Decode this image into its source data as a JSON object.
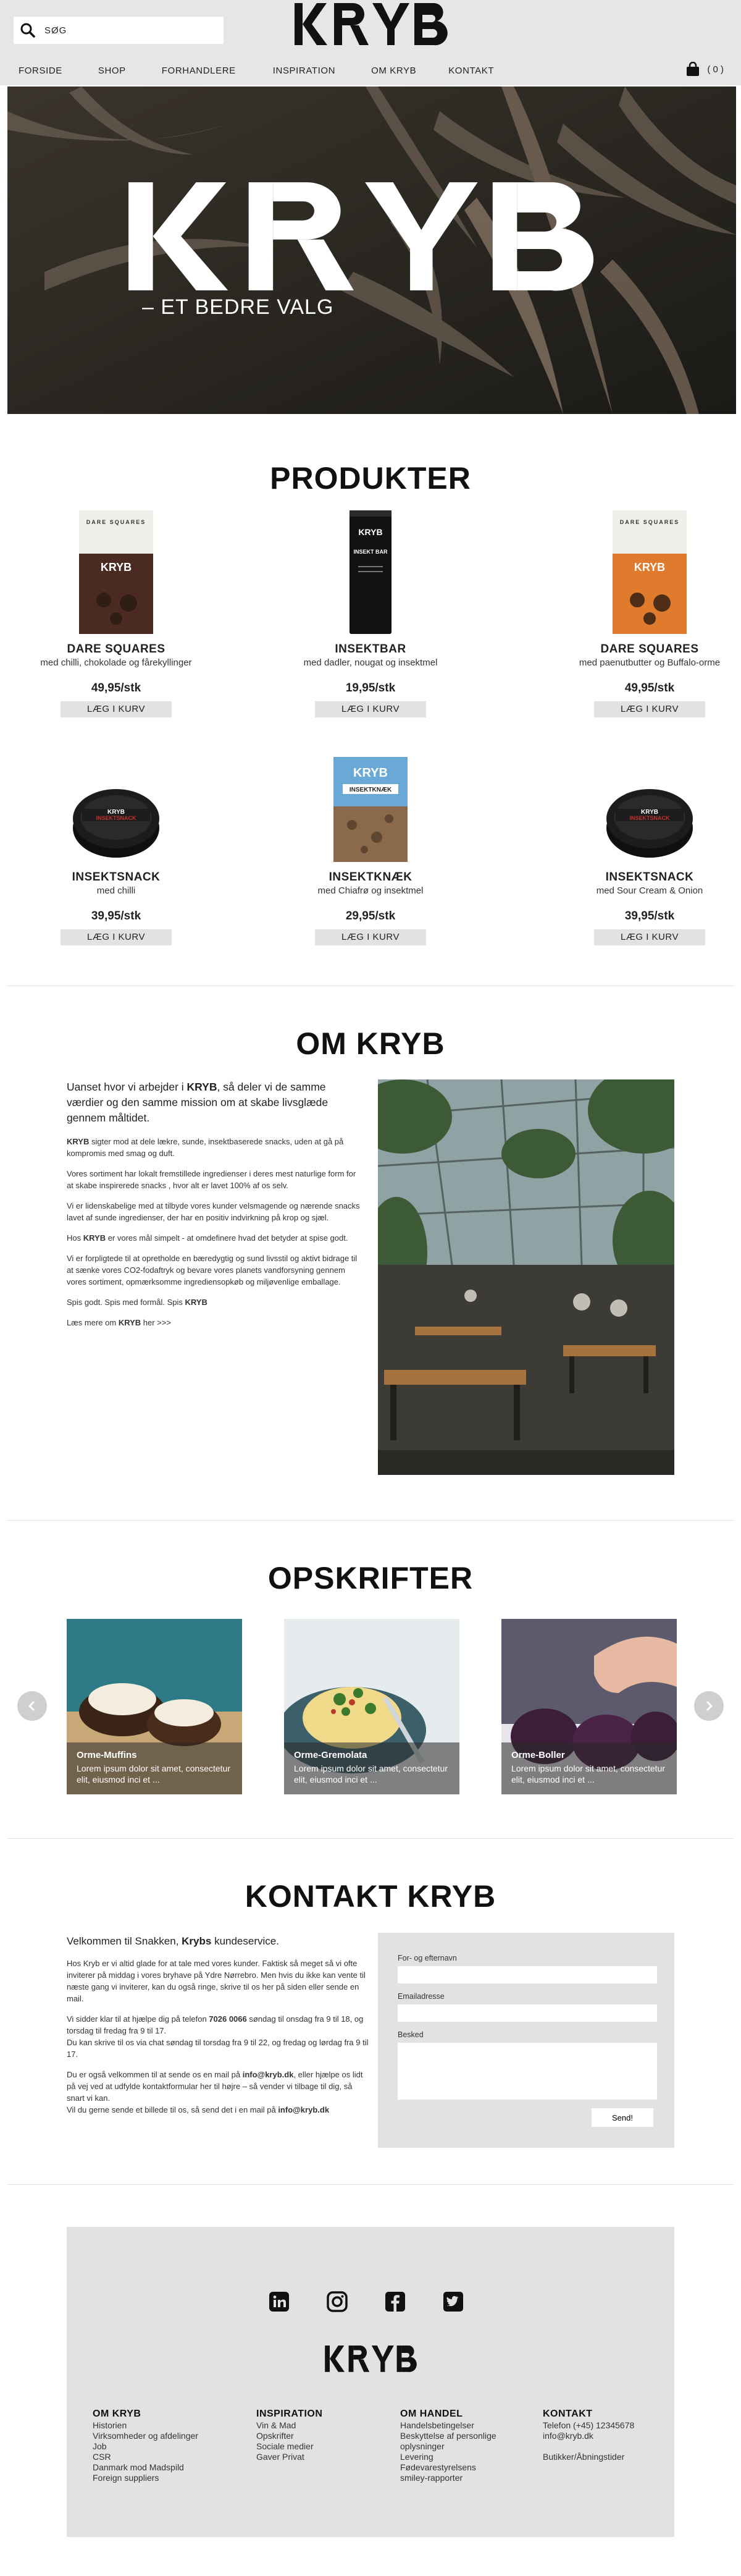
{
  "search": {
    "placeholder": "SØG"
  },
  "brand": {
    "logo_text": "KRYB",
    "tagline": "– ET BEDRE VALG"
  },
  "nav": [
    "FORSIDE",
    "SHOP",
    "FORHANDLERE",
    "INSPIRATION",
    "OM KRYB",
    "KONTAKT"
  ],
  "cart": {
    "count": "( 0 )"
  },
  "products": {
    "title": "PRODUKTER",
    "button_label": "LÆG I KURV",
    "items": [
      {
        "name": "DARE SQUARES",
        "desc": "med chilli, chokolade og fårekyllinger",
        "price": "49,95/stk",
        "pack_label": "DARE SQUARES",
        "pack_color": "#4b2a22"
      },
      {
        "name": "INSEKTBAR",
        "desc": "med dadler, nougat og insektmel",
        "price": "19,95/stk",
        "pack_label": "INSEKT BAR",
        "pack_color": "#111111"
      },
      {
        "name": "DARE SQUARES",
        "desc": "med paenutbutter og Buffalo-orme",
        "price": "49,95/stk",
        "pack_label": "DARE SQUARES",
        "pack_color": "#e07a2c"
      },
      {
        "name": "INSEKTSNACK",
        "desc": "med chilli",
        "price": "39,95/stk",
        "pack_label": "INSEKTSNACK",
        "pack_color": "#1c1c1c"
      },
      {
        "name": "INSEKTKNÆK",
        "desc": "med Chiafrø og insektmel",
        "price": "29,95/stk",
        "pack_label": "INSEKTKNÆK",
        "pack_color": "#8a6a4a"
      },
      {
        "name": "INSEKTSNACK",
        "desc": "med Sour Cream & Onion",
        "price": "39,95/stk",
        "pack_label": "INSEKTSNACK",
        "pack_color": "#1c1c1c"
      }
    ]
  },
  "about": {
    "title": "OM KRYB",
    "lead_pre": "Uanset hvor vi arbejder i ",
    "lead_brand": "KRYB",
    "lead_post": ", så deler vi de samme værdier og den samme mission om at skabe livsglæde gennem måltidet.",
    "p1_brand": "KRYB",
    "p1": " sigter mod at dele lækre, sunde, insektbaserede snacks, uden at gå på kompromis med smag og duft.",
    "p2": "Vores sortiment har lokalt fremstillede ingredienser i deres mest naturlige form for at skabe inspirerede snacks , hvor alt er lavet 100% af os selv.",
    "p3": "Vi er lidenskabelige med at tilbyde vores kunder velsmagende og nærende snacks lavet af sunde ingredienser, der har en positiv indvirkning på krop og sjæl.",
    "p4_pre": "Hos ",
    "p4_brand": "KRYB",
    "p4_post": " er vores mål simpelt - at omdefinere hvad det betyder at spise godt.",
    "p5": "Vi er forpligtede til at opretholde en bæredygtig og sund livsstil og aktivt bidrage til at sænke vores CO2-fodaftryk og bevare vores planets vandforsyning gennem vores sortiment, opmærksomme ingrediensopkøb og miljøvenlige emballage.",
    "p6_pre": "Spis godt. Spis med formål. Spis ",
    "p6_brand": "KRYB",
    "p7_pre": "Læs mere om ",
    "p7_brand": "KRYB",
    "p7_post": " her >>>"
  },
  "recipes": {
    "title": "OPSKRIFTER",
    "items": [
      {
        "title": "Orme-Muffins",
        "text": "Lorem ipsum dolor sit amet, consectetur elit,  eiusmod inci et ..."
      },
      {
        "title": "Orme-Gremolata",
        "text": "Lorem ipsum dolor sit amet, consectetur elit,  eiusmod inci et ..."
      },
      {
        "title": "Orme-Boller",
        "text": "Lorem ipsum dolor sit amet, consectetur elit,  eiusmod inci et ..."
      }
    ]
  },
  "contact": {
    "title": "KONTAKT KRYB",
    "lead_pre": "Velkommen til Snakken, ",
    "lead_brand": "Krybs",
    "lead_post": " kundeservice.",
    "p1": "Hos Kryb er vi altid glade for at tale med vores kunder. Faktisk så meget så vi ofte inviterer på middag i vores bryhave på Ydre Nørrebro. Men hvis du ikke kan vente til næste gang vi inviterer, kan du også ringe, skrive til os her på siden eller sende en mail.",
    "p2_pre": "Vi sidder klar til at hjælpe dig på telefon ",
    "p2_phone": "7026 0066",
    "p2_post": " søndag til onsdag fra 9 til 18, og torsdag til fredag fra 9 til 17.",
    "p2b": "Du kan skrive til os via chat søndag til torsdag fra 9 til 22, og fredag og lørdag fra 9 til 17.",
    "p3_pre": "Du er også velkommen til at sende os en mail på ",
    "p3_mail": "info@kryb.dk",
    "p3_post": ", eller hjælpe os lidt på vej ved at udfylde kontaktformular her til højre – så vender vi tilbage til dig, så snart vi kan.",
    "p4_pre": "Vil du gerne sende et billede til os, så send det i en mail på ",
    "p4_mail": "info@kryb.dk",
    "form": {
      "name_label": "For- og efternavn",
      "email_label": "Emailadresse",
      "message_label": "Besked",
      "send_label": "Send!"
    }
  },
  "footer": {
    "social_icons": [
      "linkedin-icon",
      "instagram-icon",
      "facebook-icon",
      "twitter-icon"
    ],
    "columns": [
      {
        "title": "OM KRYB",
        "items": [
          "Historien",
          "Virksomheder og afdelinger",
          "Job",
          "CSR",
          "Danmark mod Madspild",
          "Foreign suppliers"
        ]
      },
      {
        "title": "INSPIRATION",
        "items": [
          "Vin & Mad",
          "Opskrifter",
          "Sociale medier",
          "Gaver Privat"
        ]
      },
      {
        "title": "OM HANDEL",
        "items": [
          "Handelsbetingelser",
          "Beskyttelse af personlige",
          "oplysninger",
          "Levering",
          "Fødevarestyrelsens",
          "smiley-rapporter"
        ]
      },
      {
        "title": "KONTAKT",
        "items": [
          "Telefon (+45) 12345678",
          "info@kryb.dk",
          "",
          "Butikker/Åbningstider"
        ]
      }
    ]
  }
}
